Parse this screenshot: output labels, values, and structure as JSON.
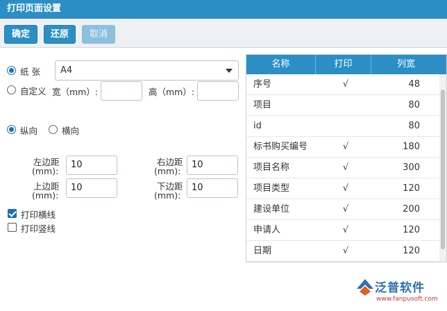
{
  "window": {
    "title": "打印页面设置"
  },
  "toolbar": {
    "ok_label": "确定",
    "reset_label": "还原",
    "cancel_label": "取消"
  },
  "paper": {
    "paper_label": "纸 张",
    "paper_value": "A4",
    "custom_label": "自定义",
    "width_label": "宽（mm）:",
    "width_value": "",
    "height_label": "高（mm）:",
    "height_value": ""
  },
  "orientation": {
    "portrait_label": "纵向",
    "landscape_label": "横向",
    "selected": "portrait"
  },
  "margins": {
    "left_label_1": "左边距",
    "left_label_2": "(mm):",
    "left_value": "10",
    "right_label_1": "右边距",
    "right_label_2": "(mm):",
    "right_value": "10",
    "top_label_1": "上边距",
    "top_label_2": "(mm):",
    "top_value": "10",
    "bottom_label_1": "下边距",
    "bottom_label_2": "(mm):",
    "bottom_value": "10"
  },
  "options": {
    "print_hlines_label": "打印横线",
    "print_hlines_checked": true,
    "print_vlines_label": "打印竖线",
    "print_vlines_checked": false
  },
  "columns": {
    "headers": [
      "名称",
      "打印",
      "列宽"
    ],
    "rows": [
      {
        "name": "序号",
        "print": "√",
        "width": "48"
      },
      {
        "name": "项目",
        "print": "",
        "width": "80"
      },
      {
        "name": "id",
        "print": "",
        "width": "80"
      },
      {
        "name": "标书购买编号",
        "print": "√",
        "width": "180"
      },
      {
        "name": "项目名称",
        "print": "√",
        "width": "300"
      },
      {
        "name": "项目类型",
        "print": "√",
        "width": "120"
      },
      {
        "name": "建设单位",
        "print": "√",
        "width": "200"
      },
      {
        "name": "申请人",
        "print": "√",
        "width": "120"
      },
      {
        "name": "日期",
        "print": "√",
        "width": "120"
      }
    ]
  },
  "watermark": {
    "brand": "泛普软件",
    "url": "www.fanpusoft.com"
  },
  "colors": {
    "accent": "#2b8fc5",
    "radio": "#1e6fb5"
  }
}
